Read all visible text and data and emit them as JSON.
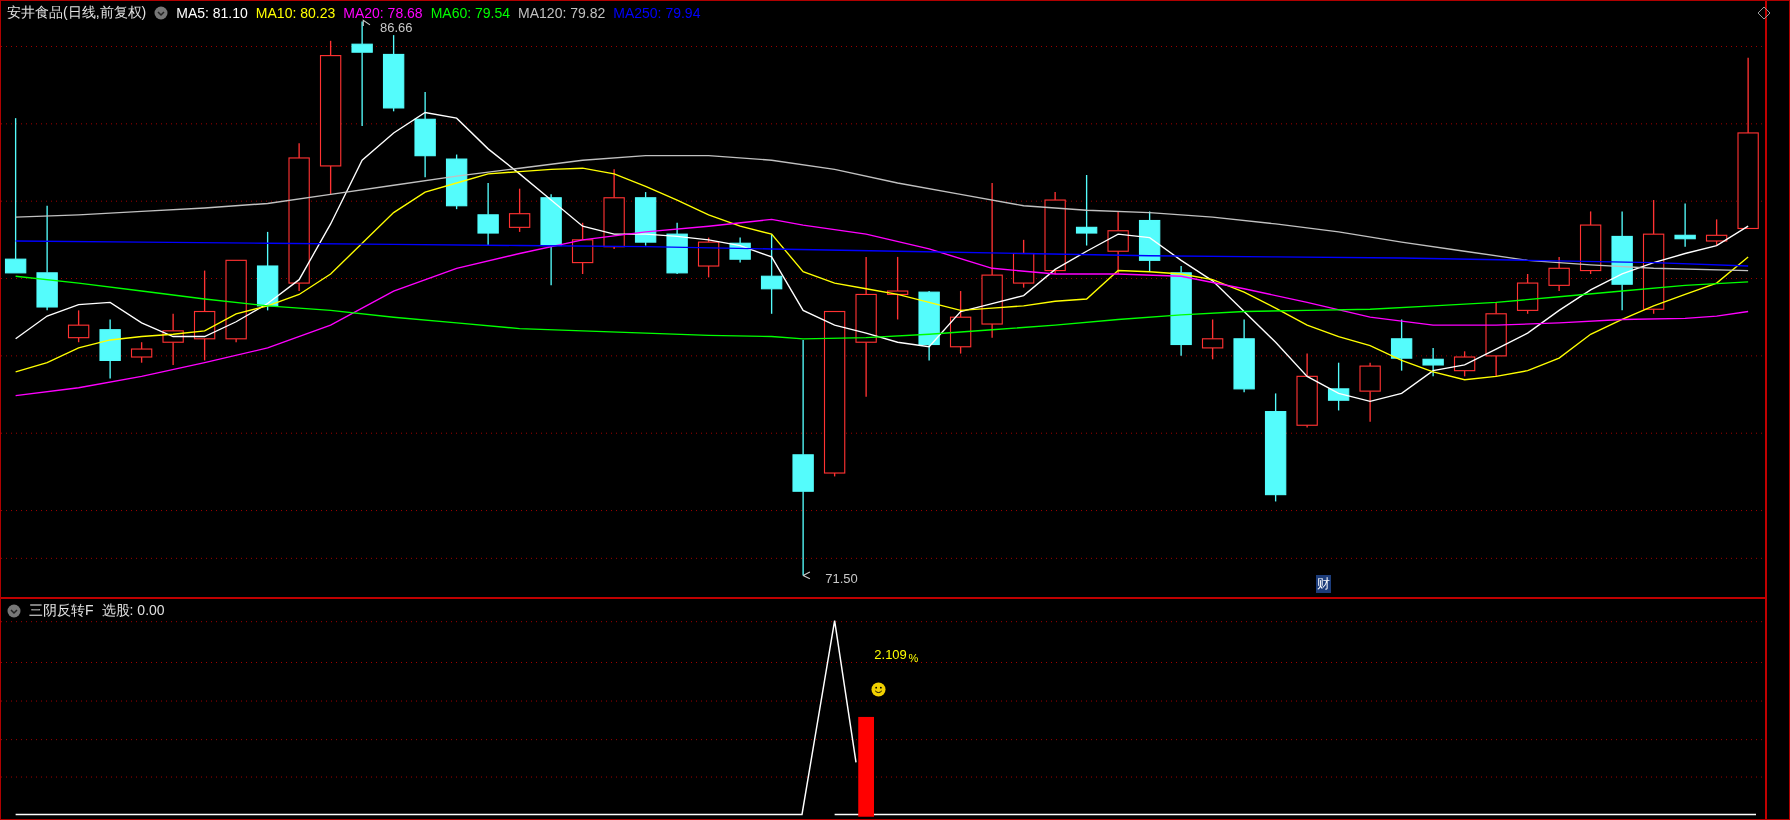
{
  "main_panel": {
    "title": "安井食品(日线,前复权)",
    "moving_averages": [
      {
        "label": "MA5:",
        "value": "81.10",
        "color": "#ffffff"
      },
      {
        "label": "MA10:",
        "value": "80.23",
        "color": "#ffff00"
      },
      {
        "label": "MA20:",
        "value": "78.68",
        "color": "#ff00ff"
      },
      {
        "label": "MA60:",
        "value": "79.54",
        "color": "#00ff00"
      },
      {
        "label": "MA120:",
        "value": "79.82",
        "color": "#c0c0c0"
      },
      {
        "label": "MA250:",
        "value": "79.94",
        "color": "#0000ff"
      }
    ],
    "high_label": "86.66",
    "low_label": "71.50",
    "event_marker": "财"
  },
  "indicator_panel": {
    "title": "三阴反转F",
    "reading": "选股: 0.00",
    "signal_value": "2.109",
    "signal_unit": "%"
  }
}
